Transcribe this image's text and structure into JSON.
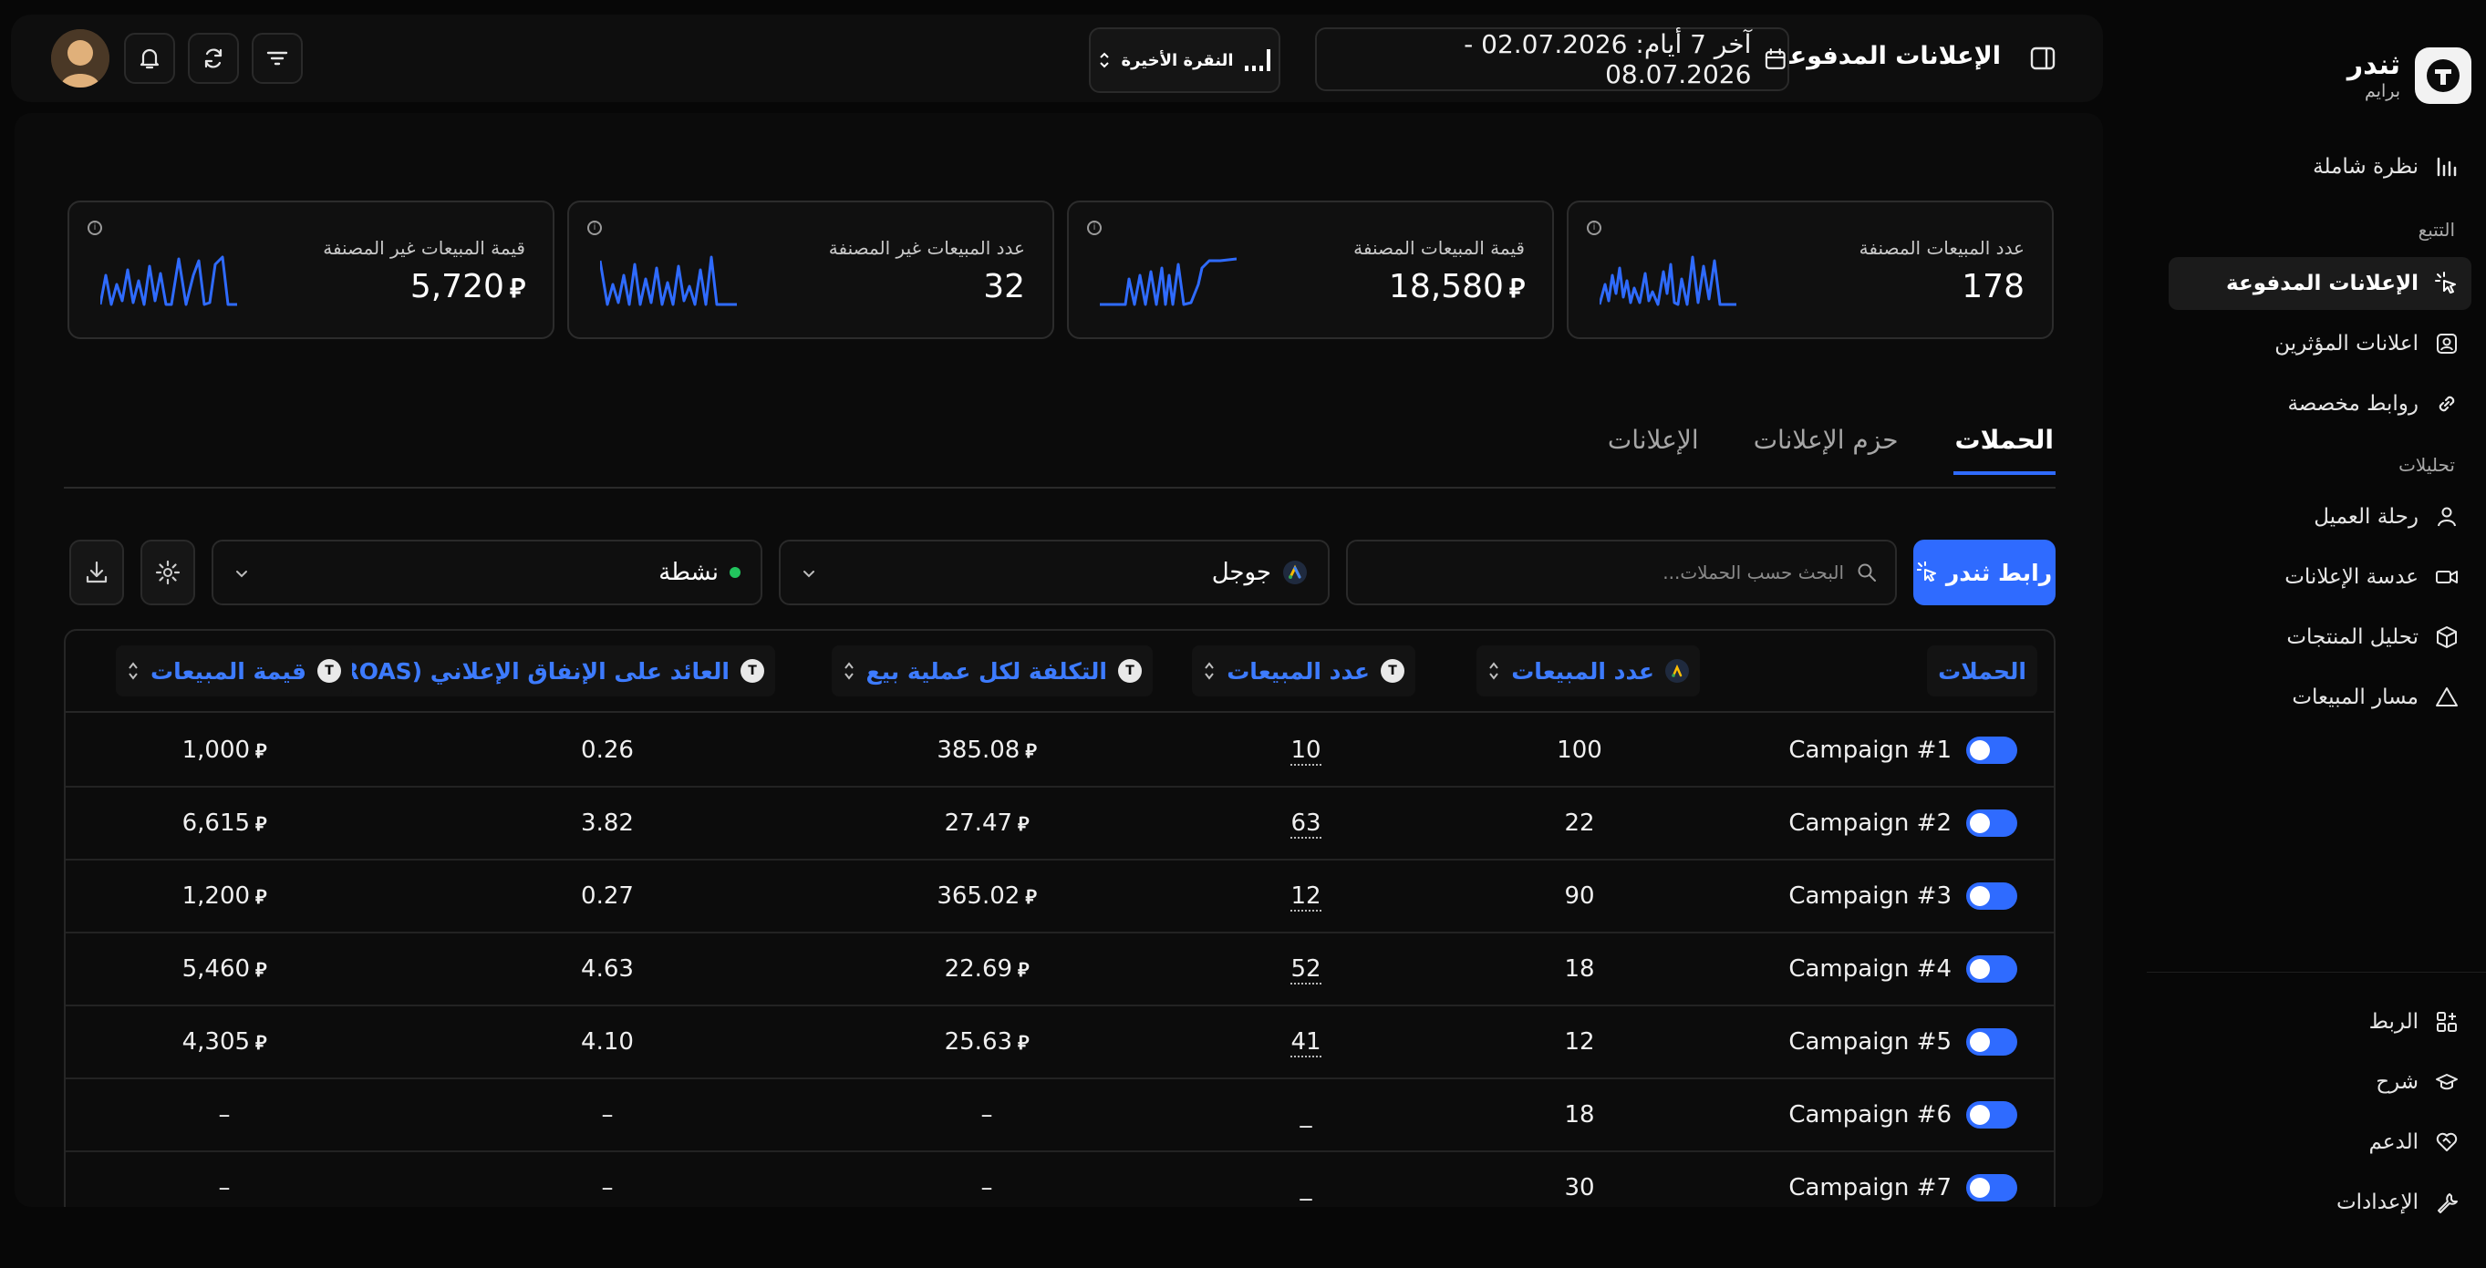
{
  "brand": {
    "name": "ثندر",
    "plan": "برايم",
    "logo_letter": "T"
  },
  "sidebar": {
    "overview": "نظرة شاملة",
    "section_tracking": "التتبع",
    "paid_ads": "الإعلانات المدفوعة",
    "influencer_ads": "اعلانات المؤثرين",
    "custom_links": "روابط مخصصة",
    "section_analytics": "تحليلات",
    "customer_journey": "رحلة العميل",
    "ads_lens": "عدسة الإعلانات",
    "product_analysis": "تحليل المنتجات",
    "sales_funnel": "مسار المبيعات",
    "integrations": "الربط",
    "guide": "شرح",
    "support": "الدعم",
    "settings": "الإعدادات"
  },
  "topbar": {
    "title": "الإعلانات المدفوعة",
    "date_range": "آخر 7 أيام: 02.07.2026 - 08.07.2026",
    "attribution": "النقرة الأخيرة"
  },
  "kpis": [
    {
      "label": "عدد المبيعات المصنفة",
      "value": "178",
      "currency": ""
    },
    {
      "label": "قيمة المبيعات المصنفة",
      "value": "18,580",
      "currency": "⃁"
    },
    {
      "label": "عدد المبيعات غير المصنفة",
      "value": "32",
      "currency": ""
    },
    {
      "label": "قيمة المبيعات غير المصنفة",
      "value": "5,720",
      "currency": "⃁"
    }
  ],
  "tabs": {
    "campaigns": "الحملات",
    "ad_sets": "حزم الإعلانات",
    "ads": "الإعلانات"
  },
  "toolbar": {
    "link_button": "رابط ثندر",
    "search_placeholder": "البحث حسب الحملات...",
    "platform": "جوجل",
    "status": "نشطة"
  },
  "table": {
    "headers": {
      "campaigns": "الحملات",
      "sales_count_platform": "عدد المبيعات",
      "sales_count_thunder": "عدد المبيعات",
      "cost_per_sale": "التكلفة لكل عملية بيع",
      "roas": "العائد على الإنفاق الإعلاني (ROAS)",
      "sales_value": "قيمة المبيعات"
    },
    "currency_symbol": "⃁",
    "rows": [
      {
        "name": "Campaign #1",
        "platform_sales": "100",
        "thunder_sales": "10",
        "cpa": "385.08",
        "roas": "0.26",
        "value": "1,000"
      },
      {
        "name": "Campaign #2",
        "platform_sales": "22",
        "thunder_sales": "63",
        "cpa": "27.47",
        "roas": "3.82",
        "value": "6,615"
      },
      {
        "name": "Campaign #3",
        "platform_sales": "90",
        "thunder_sales": "12",
        "cpa": "365.02",
        "roas": "0.27",
        "value": "1,200"
      },
      {
        "name": "Campaign #4",
        "platform_sales": "18",
        "thunder_sales": "52",
        "cpa": "22.69",
        "roas": "4.63",
        "value": "5,460"
      },
      {
        "name": "Campaign #5",
        "platform_sales": "12",
        "thunder_sales": "41",
        "cpa": "25.63",
        "roas": "4.10",
        "value": "4,305"
      },
      {
        "name": "Campaign #6",
        "platform_sales": "18",
        "thunder_sales": "_",
        "cpa": "–",
        "roas": "–",
        "value": "–"
      },
      {
        "name": "Campaign #7",
        "platform_sales": "30",
        "thunder_sales": "_",
        "cpa": "–",
        "roas": "–",
        "value": "–"
      }
    ]
  },
  "colors": {
    "accent": "#2f6bff",
    "toggle_on": "#2f6bff",
    "status_dot": "#22c55e",
    "background": "#070707"
  }
}
